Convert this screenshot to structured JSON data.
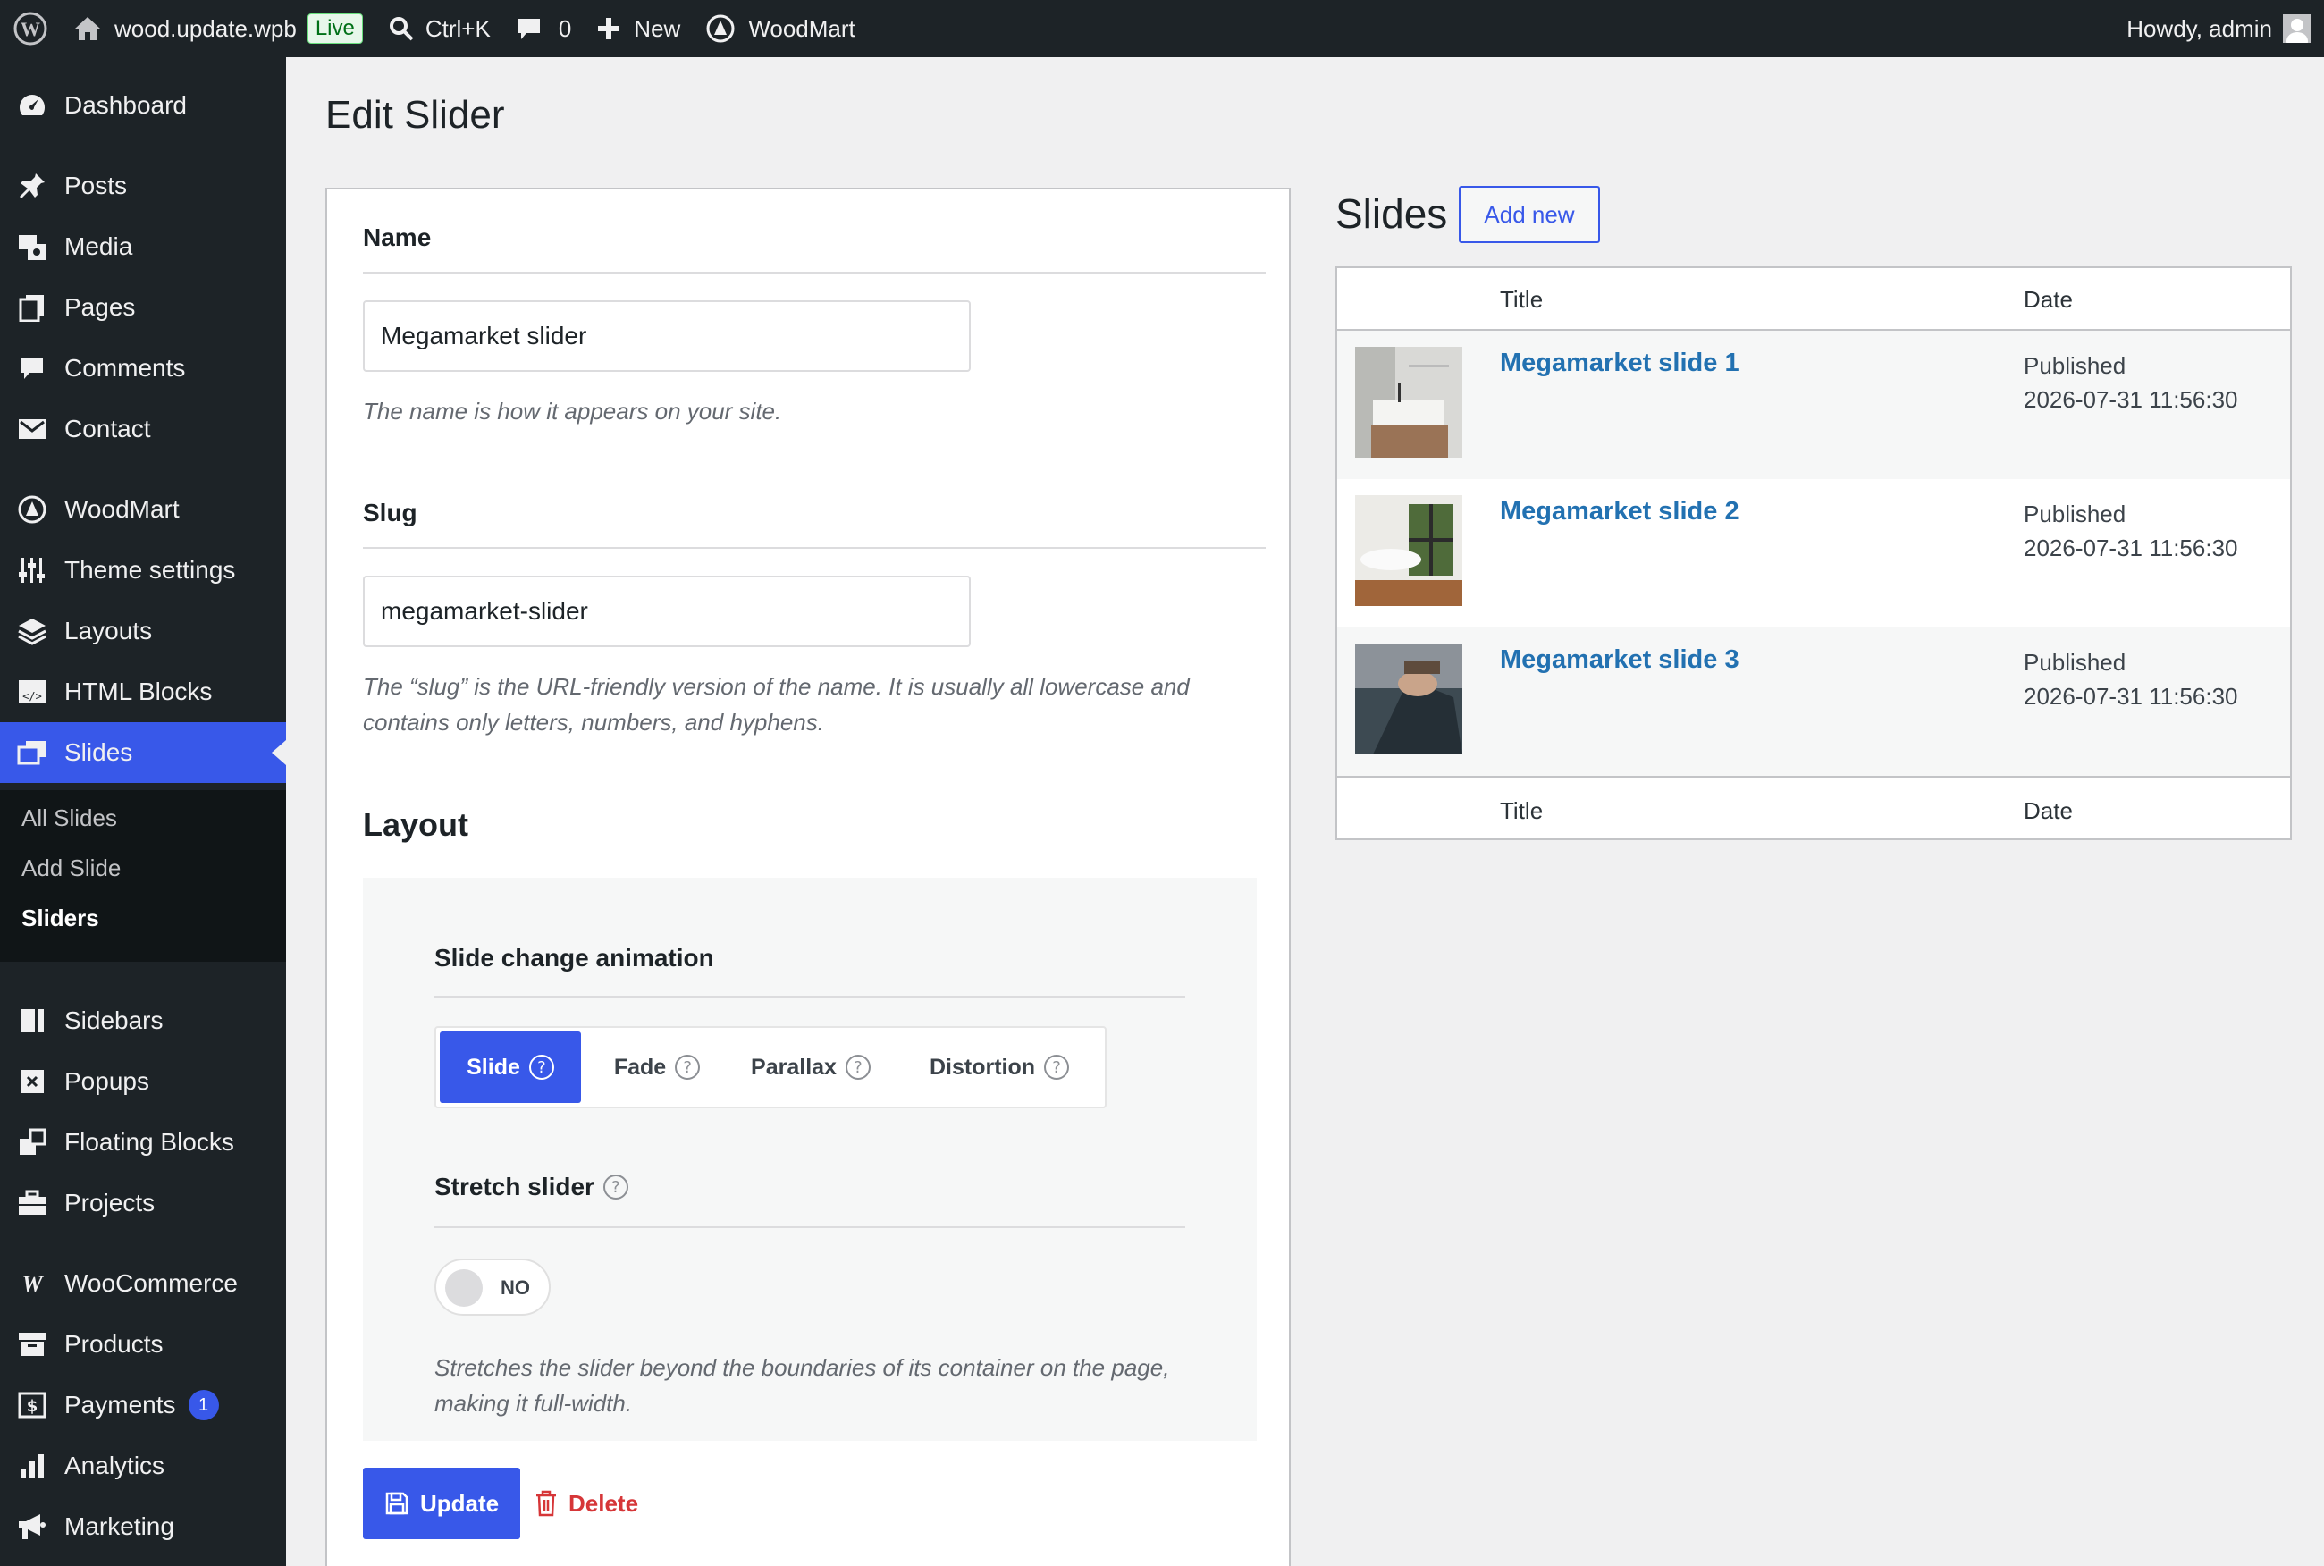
{
  "adminbar": {
    "site_name": "wood.update.wpb",
    "live_badge": "Live",
    "search_shortcut": "Ctrl+K",
    "comments_count": "0",
    "new_label": "New",
    "theme_label": "WoodMart",
    "greeting": "Howdy, admin"
  },
  "sidebar": {
    "items": [
      {
        "label": "Dashboard",
        "icon": "dashboard-icon"
      },
      {
        "label": "Posts",
        "icon": "pin-icon"
      },
      {
        "label": "Media",
        "icon": "media-icon"
      },
      {
        "label": "Pages",
        "icon": "pages-icon"
      },
      {
        "label": "Comments",
        "icon": "comment-icon"
      },
      {
        "label": "Contact",
        "icon": "mail-icon"
      },
      {
        "label": "WoodMart",
        "icon": "woodmart-icon"
      },
      {
        "label": "Theme settings",
        "icon": "sliders-icon"
      },
      {
        "label": "Layouts",
        "icon": "layers-icon"
      },
      {
        "label": "HTML Blocks",
        "icon": "html-block-icon"
      },
      {
        "label": "Slides",
        "icon": "slides-icon"
      },
      {
        "label": "Sidebars",
        "icon": "sidebar-icon"
      },
      {
        "label": "Popups",
        "icon": "popup-icon"
      },
      {
        "label": "Floating Blocks",
        "icon": "floating-blocks-icon"
      },
      {
        "label": "Projects",
        "icon": "briefcase-icon"
      },
      {
        "label": "WooCommerce",
        "icon": "woocommerce-icon"
      },
      {
        "label": "Products",
        "icon": "archive-icon"
      },
      {
        "label": "Payments",
        "icon": "payments-icon",
        "badge": "1"
      },
      {
        "label": "Analytics",
        "icon": "chart-bar-icon"
      },
      {
        "label": "Marketing",
        "icon": "megaphone-icon"
      }
    ],
    "submenu": [
      "All Slides",
      "Add Slide",
      "Sliders"
    ]
  },
  "page": {
    "title": "Edit Slider",
    "name_label": "Name",
    "name_value": "Megamarket slider",
    "name_help": "The name is how it appears on your site.",
    "slug_label": "Slug",
    "slug_value": "megamarket-slider",
    "slug_help": "The “slug” is the URL-friendly version of the name. It is usually all lowercase and contains only letters, numbers, and hyphens.",
    "layout_title": "Layout",
    "animation_label": "Slide change animation",
    "animation_options": [
      "Slide",
      "Fade",
      "Parallax",
      "Distortion"
    ],
    "animation_selected": "Slide",
    "stretch_label": "Stretch slider",
    "stretch_value": "NO",
    "stretch_help": "Stretches the slider beyond the boundaries of its container on the page, making it full-width.",
    "update_label": "Update",
    "delete_label": "Delete"
  },
  "slides": {
    "heading": "Slides",
    "add_new": "Add new",
    "columns": [
      "Title",
      "Date"
    ],
    "rows": [
      {
        "title": "Megamarket slide 1",
        "status": "Published",
        "date": "2026-07-31 11:56:30"
      },
      {
        "title": "Megamarket slide 2",
        "status": "Published",
        "date": "2026-07-31 11:56:30"
      },
      {
        "title": "Megamarket slide 3",
        "status": "Published",
        "date": "2026-07-31 11:56:30"
      }
    ]
  },
  "colors": {
    "admin_dark": "#1d2327",
    "accent": "#3858e9",
    "link": "#2271b1",
    "danger": "#d63638"
  }
}
